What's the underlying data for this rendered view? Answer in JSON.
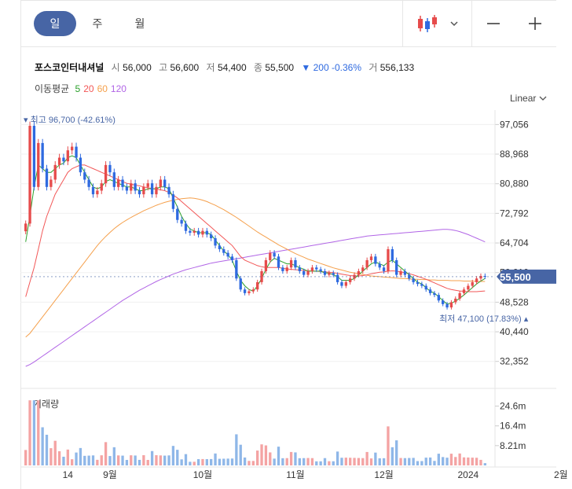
{
  "toolbar": {
    "tabs": [
      "일",
      "주",
      "월"
    ],
    "active_tab": 0
  },
  "stock": {
    "name": "포스코인터내셔널",
    "open_label": "시",
    "open": "56,000",
    "high_label": "고",
    "high": "56,600",
    "low_label": "저",
    "low": "54,400",
    "close_label": "종",
    "close": "55,500",
    "change": "▼ 200 -0.36%",
    "volume_label": "거",
    "volume": "556,133"
  },
  "ma_legend": {
    "label": "이동평균",
    "items": [
      {
        "period": "5",
        "color": "#2ba02b"
      },
      {
        "period": "20",
        "color": "#f25757"
      },
      {
        "period": "60",
        "color": "#f5a04c"
      },
      {
        "period": "120",
        "color": "#b165e6"
      }
    ]
  },
  "scale_label": "Linear",
  "colors": {
    "up": "#e64b4b",
    "down": "#2f6ae0",
    "accent": "#4765a5",
    "volume": "#8fb7e8"
  },
  "chart_data": {
    "type": "candlestick",
    "title": "",
    "price_axis": {
      "ticks": [
        "97,056",
        "88,968",
        "80,880",
        "72,792",
        "64,704",
        "56,616",
        "48,528",
        "40,440",
        "32,352"
      ],
      "ylim": [
        28000,
        101000
      ]
    },
    "volume_axis": {
      "label": "거래량",
      "ticks": [
        "24.6m",
        "16.4m",
        "8.21m"
      ],
      "ylim": [
        0,
        30000000
      ]
    },
    "x_labels": [
      "14",
      "9월",
      "10월",
      "11월",
      "12월",
      "2024",
      "2월"
    ],
    "x_label_index": [
      10,
      20,
      42,
      64,
      85,
      105,
      127
    ],
    "last_price": "55,500",
    "max_annotation": "최고 96,700 (-42.61%)",
    "min_annotation": "최저 47,100 (17.83%)",
    "max_index": 1,
    "min_index": 120,
    "closes": [
      70000,
      96700,
      80000,
      92000,
      85000,
      80000,
      82000,
      86000,
      88000,
      87000,
      90000,
      91000,
      88000,
      84000,
      82000,
      80000,
      78000,
      79000,
      81000,
      86000,
      84000,
      80000,
      82000,
      80000,
      79000,
      81000,
      79000,
      78000,
      80000,
      81000,
      78000,
      80000,
      82000,
      80000,
      78000,
      74000,
      71000,
      70000,
      68000,
      67500,
      68000,
      67000,
      68000,
      67000,
      66000,
      64000,
      63000,
      62000,
      61000,
      60000,
      55000,
      52000,
      51000,
      51500,
      52000,
      54000,
      57000,
      60000,
      62000,
      61000,
      58000,
      57000,
      58000,
      60000,
      58000,
      57000,
      56000,
      57000,
      58000,
      57500,
      57000,
      56000,
      56500,
      56000,
      54000,
      53000,
      54000,
      55000,
      56000,
      57000,
      58000,
      60000,
      61000,
      59000,
      58000,
      57000,
      63000,
      60000,
      56000,
      57000,
      56000,
      55000,
      54000,
      53500,
      53000,
      52000,
      51000,
      50500,
      49000,
      48000,
      47100,
      48500,
      49500,
      51000,
      52000,
      53000,
      54000,
      55000,
      55700,
      55500
    ],
    "ma": {
      "ma5": [
        65000,
        72000,
        80000,
        86000,
        85000,
        84000,
        84000,
        85000,
        86000,
        86500,
        88000,
        88500,
        88000,
        86000,
        84000,
        82000,
        80000,
        79500,
        80000,
        81500,
        82000,
        81500,
        81000,
        80500,
        80000,
        80000,
        79500,
        79000,
        79000,
        79500,
        79500,
        79500,
        80000,
        80000,
        79500,
        77000,
        74500,
        72000,
        70000,
        68500,
        68000,
        67500,
        67500,
        67500,
        67000,
        65500,
        64000,
        62500,
        61500,
        60000,
        57000,
        54500,
        53000,
        52000,
        51500,
        53000,
        55000,
        57500,
        59500,
        60500,
        60000,
        59500,
        59000,
        59000,
        58500,
        58000,
        57500,
        57000,
        57000,
        57000,
        57000,
        56500,
        56500,
        56000,
        55500,
        54500,
        54500,
        54500,
        55000,
        56000,
        57000,
        58000,
        59000,
        59500,
        59000,
        58500,
        59500,
        60000,
        59000,
        58000,
        57000,
        56000,
        55000,
        54000,
        53500,
        52500,
        51500,
        51000,
        50000,
        49000,
        48000,
        48300,
        48800,
        49600,
        50500,
        51500,
        52500,
        53500,
        54300,
        55000
      ],
      "ma20": [
        50000,
        54000,
        58000,
        63000,
        68000,
        72000,
        75000,
        78000,
        80000,
        82000,
        84000,
        85000,
        85500,
        86000,
        86000,
        85500,
        85000,
        84500,
        84000,
        83500,
        83000,
        82500,
        82000,
        81500,
        81000,
        80800,
        80500,
        80300,
        80000,
        79800,
        79600,
        79400,
        79200,
        79000,
        78500,
        77800,
        77000,
        76000,
        75000,
        74000,
        73000,
        72000,
        71000,
        70000,
        69000,
        68000,
        67000,
        66000,
        65000,
        64000,
        62500,
        61000,
        60000,
        59500,
        59000,
        58500,
        58200,
        58000,
        58000,
        58000,
        58000,
        57800,
        57600,
        57500,
        57400,
        57300,
        57200,
        57100,
        57000,
        57000,
        56900,
        56800,
        56700,
        56600,
        56400,
        56200,
        56000,
        55800,
        55700,
        55700,
        55800,
        56000,
        56300,
        56500,
        56700,
        56800,
        57000,
        57100,
        57000,
        56800,
        56600,
        56300,
        56000,
        55600,
        55200,
        54800,
        54300,
        53800,
        53300,
        52800,
        52300,
        52000,
        51800,
        51600,
        51500,
        51400,
        51400,
        51400,
        51500,
        51600
      ],
      "ma60": [
        39000,
        40000,
        41500,
        43000,
        44500,
        46000,
        47500,
        49000,
        50500,
        52000,
        53500,
        55000,
        56500,
        58000,
        59500,
        61000,
        62500,
        64000,
        65300,
        66500,
        67600,
        68600,
        69500,
        70300,
        71000,
        71700,
        72300,
        72900,
        73500,
        74000,
        74500,
        75000,
        75400,
        75800,
        76100,
        76400,
        76600,
        76800,
        76900,
        77000,
        76900,
        76700,
        76400,
        76000,
        75500,
        75000,
        74400,
        73800,
        73100,
        72400,
        71700,
        70900,
        70100,
        69300,
        68500,
        67700,
        67000,
        66300,
        65600,
        64900,
        64200,
        63600,
        63000,
        62400,
        61800,
        61300,
        60800,
        60300,
        59900,
        59500,
        59100,
        58700,
        58300,
        57900,
        57600,
        57300,
        57000,
        56700,
        56500,
        56300,
        56100,
        55900,
        55700,
        55600,
        55500,
        55400,
        55300,
        55200,
        55100,
        55000,
        55000,
        54900,
        54800,
        54800,
        54700,
        54700,
        54600,
        54600,
        54500,
        54500,
        54500,
        54400,
        54400,
        54400,
        54300,
        54300,
        54300,
        54200,
        54200,
        54200
      ],
      "ma120": [
        31000,
        31500,
        32200,
        33000,
        33800,
        34600,
        35400,
        36200,
        37000,
        37800,
        38600,
        39400,
        40200,
        41000,
        41800,
        42600,
        43400,
        44200,
        45000,
        45800,
        46600,
        47400,
        48200,
        49000,
        49700,
        50400,
        51100,
        51800,
        52400,
        53000,
        53600,
        54200,
        54700,
        55200,
        55700,
        56200,
        56600,
        57000,
        57400,
        57700,
        58000,
        58300,
        58600,
        58900,
        59200,
        59400,
        59600,
        59800,
        60000,
        60200,
        60400,
        60600,
        60800,
        61000,
        61200,
        61400,
        61600,
        61800,
        62000,
        62200,
        62400,
        62600,
        62800,
        63000,
        63200,
        63400,
        63600,
        63800,
        64000,
        64200,
        64400,
        64600,
        64800,
        65000,
        65200,
        65400,
        65600,
        65800,
        66000,
        66200,
        66400,
        66600,
        66700,
        66800,
        66900,
        67000,
        67100,
        67200,
        67300,
        67400,
        67500,
        67600,
        67700,
        67800,
        67900,
        68000,
        68100,
        68200,
        68300,
        68400,
        68400,
        68300,
        68100,
        67800,
        67400,
        67000,
        66500,
        66000,
        65500,
        65000
      ]
    }
  }
}
